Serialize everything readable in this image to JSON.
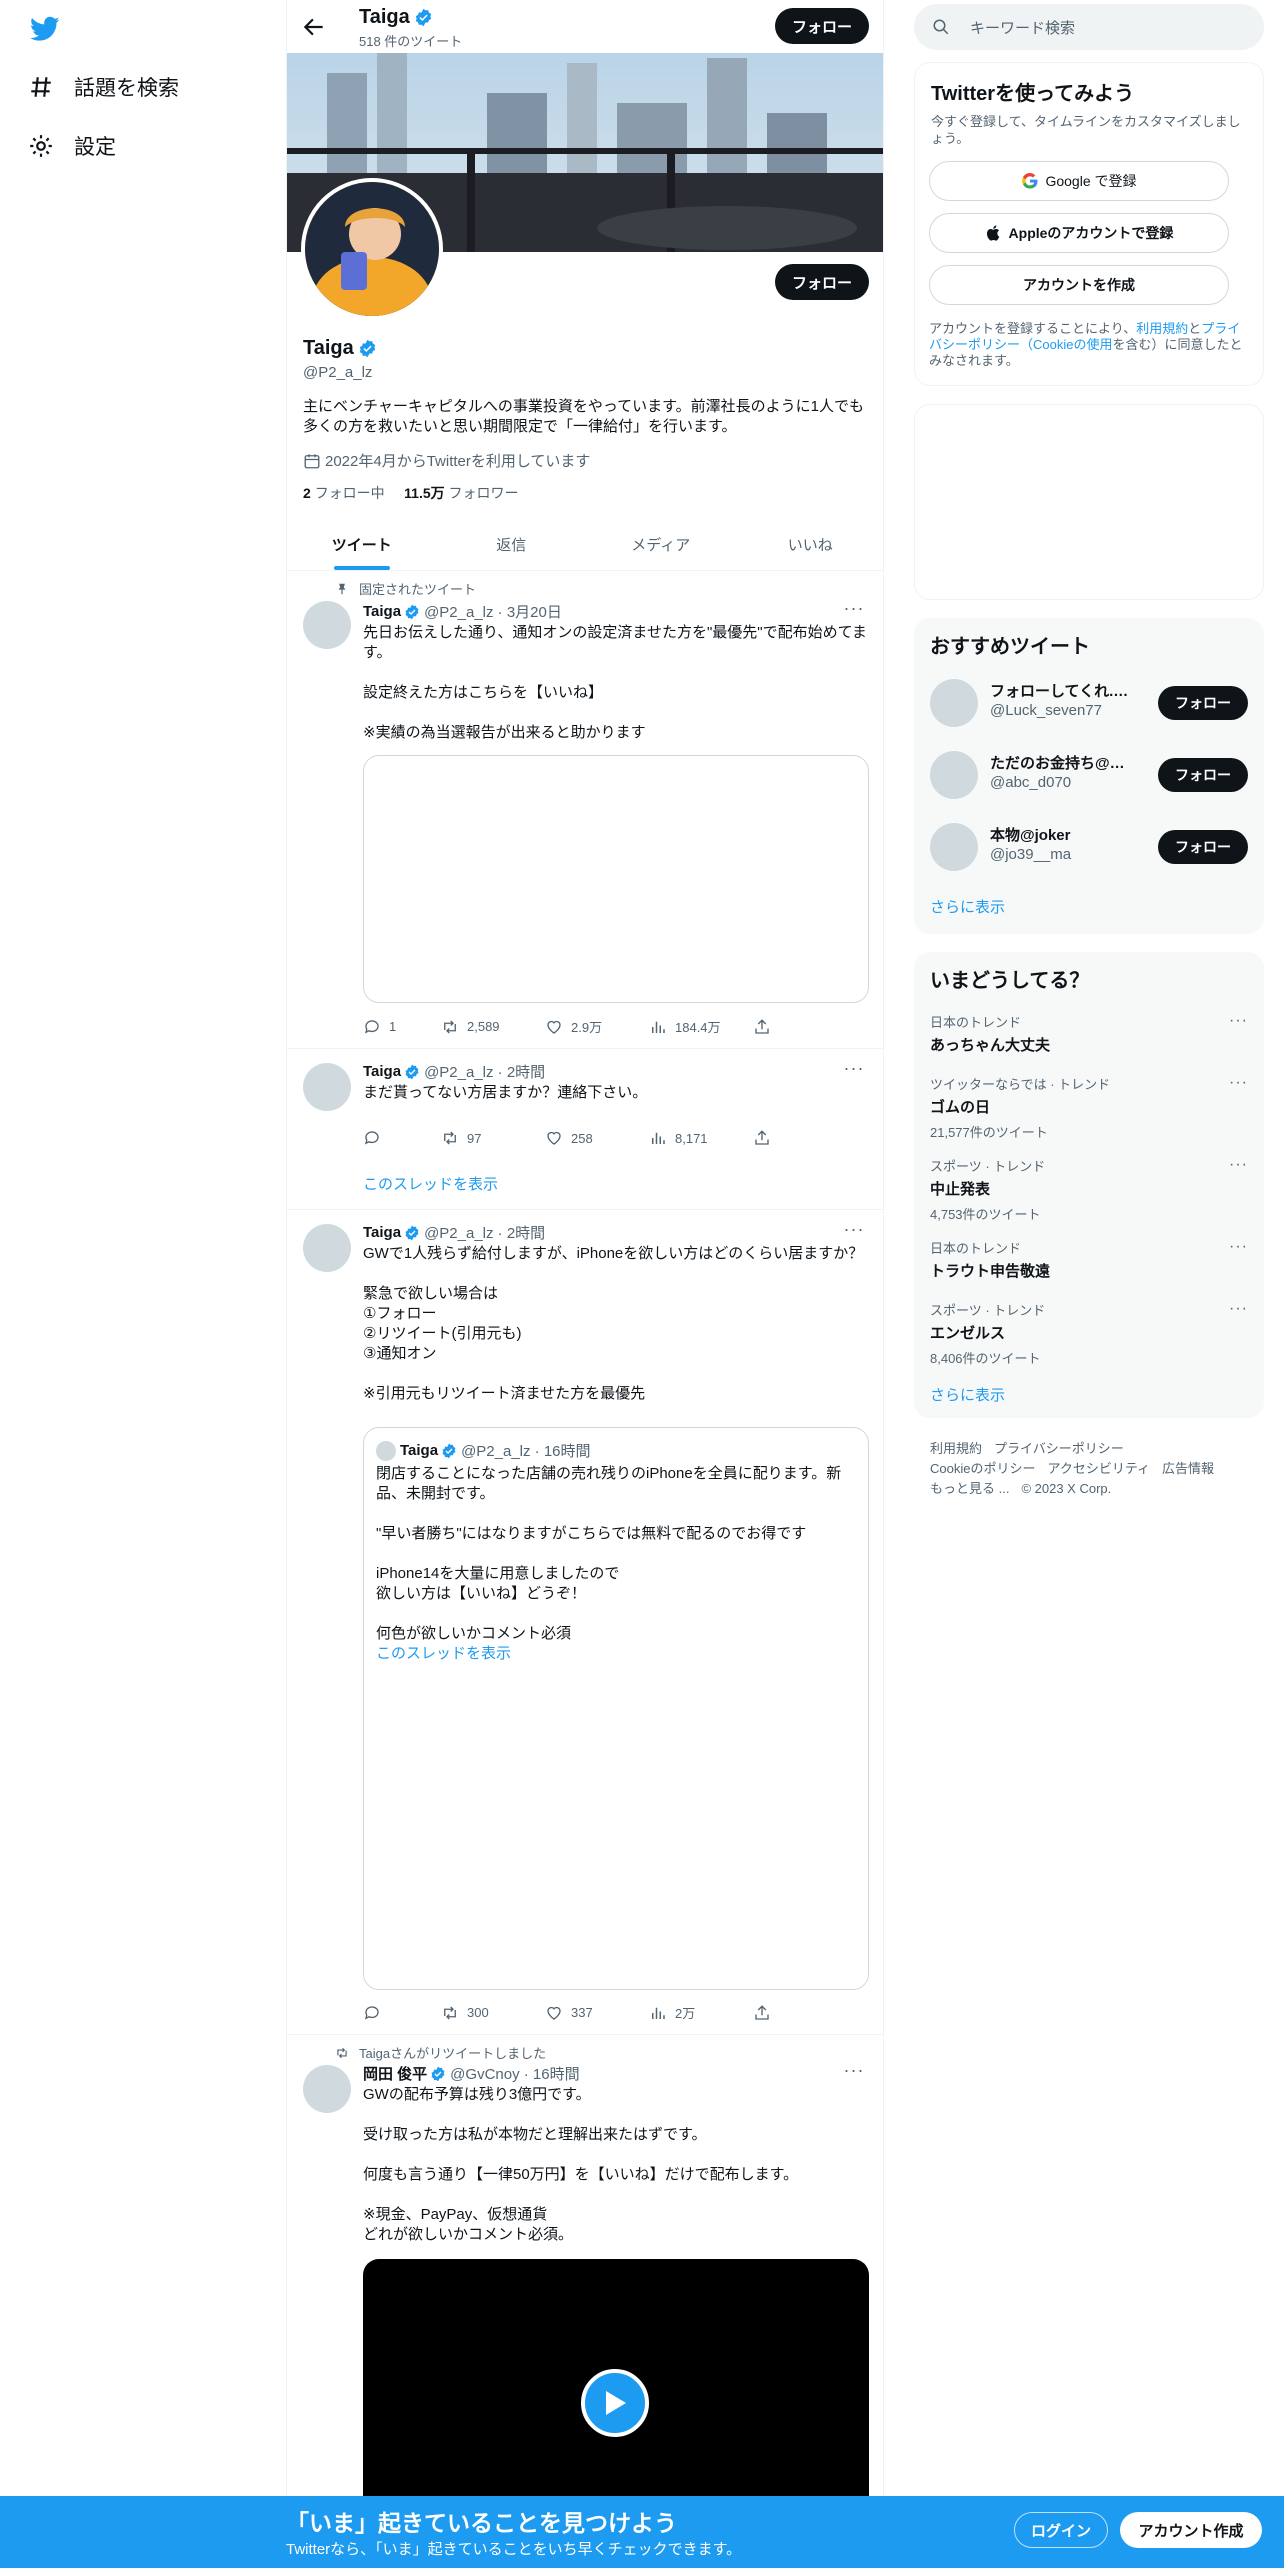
{
  "nav": {
    "explore_label": "話題を検索",
    "settings_label": "設定"
  },
  "profile": {
    "top_name": "Taiga",
    "tweet_count": "518 件のツイート",
    "follow_label": "フォロー",
    "name": "Taiga",
    "handle": "@P2_a_lz",
    "bio": "主にベンチャーキャピタルへの事業投資をやっています。前澤社長のように1人でも多くの方を救いたいと思い期間限定で「一律給付」を行います。",
    "joined": "2022年4月からTwitterを利用しています",
    "following_count": "2",
    "following_label": "フォロー中",
    "followers_count": "11.5万",
    "followers_label": "フォロワー"
  },
  "tabs": [
    "ツイート",
    "返信",
    "メディア",
    "いいね"
  ],
  "tweets": [
    {
      "context": "固定されたツイート",
      "name": "Taiga",
      "handle": "@P2_a_lz · 3月20日",
      "body": "先日お伝えした通り、通知オンの設定済ませた方を\"最優先\"で配布始めてます。\n\n設定終えた方はこちらを【いいね】\n\n※実績の為当選報告が出来ると助かります",
      "reply": "1",
      "retweet": "2,589",
      "like": "2.9万",
      "views": "184.4万"
    },
    {
      "name": "Taiga",
      "handle": "@P2_a_lz · 2時間",
      "body": "まだ貰ってない方居ますか？連絡下さい。",
      "reply": "",
      "retweet": "97",
      "like": "258",
      "views": "8,171",
      "show_thread": "このスレッドを表示"
    },
    {
      "name": "Taiga",
      "handle": "@P2_a_lz · 2時間",
      "body": "GWで1人残らず給付しますが、iPhoneを欲しい方はどのくらい居ますか？\n\n緊急で欲しい場合は\n①フォロー\n②リツイート(引用元も)\n③通知オン\n\n※引用元もリツイート済ませた方を最優先",
      "quote": {
        "name": "Taiga",
        "handle": "@P2_a_lz · 16時間",
        "body": "閉店することになった店舗の売れ残りのiPhoneを全員に配ります。新品、未開封です。\n\n\"早い者勝ち\"にはなりますがこちらでは無料で配るのでお得です\n\niPhone14を大量に用意しましたので\n欲しい方は【いいね】どうぞ！\n\n何色が欲しいかコメント必須",
        "show_thread": "このスレッドを表示"
      },
      "reply": "",
      "retweet": "300",
      "like": "337",
      "views": "2万"
    },
    {
      "context": "Taigaさんがリツイートしました",
      "name": "岡田 俊平",
      "handle": "@GvCnoy · 16時間",
      "body": "GWの配布予算は残り3億円です。\n\n受け取った方は私が本物だと理解出来たはずです。\n\n何度も言う通り【一律50万円】を【いいね】だけで配布します。\n\n※現金、PayPay、仮想通貨\nどれが欲しいかコメント必須。"
    }
  ],
  "sidebar": {
    "search_placeholder": "キーワード検索",
    "signup_title": "Twitterを使ってみよう",
    "signup_sub": "今すぐ登録して、タイムラインをカスタマイズしましょう。",
    "google_btn": "Google で登録",
    "apple_btn": "Appleのアカウントで登録",
    "create_btn": "アカウントを作成",
    "terms_a": "アカウントを登録することにより、",
    "terms_link1": "利用規約",
    "terms_b": "と",
    "terms_link2": "プライバシーポリシー（Cookieの使用",
    "terms_c": "を含む）に同意したとみなされます。",
    "rec_title": "おすすめツイート",
    "recs": [
      {
        "name": "フォローしてくれ...",
        "handle": "@Luck_seven77",
        "verified": true
      },
      {
        "name": "ただのお金持ち@新...",
        "handle": "@abc_d070",
        "verified": false
      },
      {
        "name": "本物@joker",
        "handle": "@jo39__ma",
        "verified": false
      }
    ],
    "rec_follow": "フォロー",
    "show_more": "さらに表示",
    "trends_title": "いまどうしてる？",
    "trends": [
      {
        "context": "日本のトレンド",
        "title": "あっちゃん大丈夫",
        "count": ""
      },
      {
        "context": "ツイッターならでは · トレンド",
        "title": "ゴムの日",
        "count": "21,577件のツイート"
      },
      {
        "context": "スポーツ · トレンド",
        "title": "中止発表",
        "count": "4,753件のツイート"
      },
      {
        "context": "日本のトレンド",
        "title": "トラウト申告敬遠",
        "count": ""
      },
      {
        "context": "スポーツ · トレンド",
        "title": "エンゼルス",
        "count": "8,406件のツイート"
      }
    ],
    "footer": [
      "利用規約",
      "プライバシーポリシー",
      "Cookieのポリシー",
      "アクセシビリティ",
      "広告情報",
      "もっと見る ...",
      "© 2023 X Corp."
    ]
  },
  "bottom": {
    "title": "「いま」起きていることを見つけよう",
    "subtitle": "Twitterなら、「いま」起きていることをいち早くチェックできます。",
    "login": "ログイン",
    "signup": "アカウント作成"
  },
  "colors": {
    "accent": "#1d9bf0",
    "text": "#0f1419",
    "muted": "#536471"
  }
}
